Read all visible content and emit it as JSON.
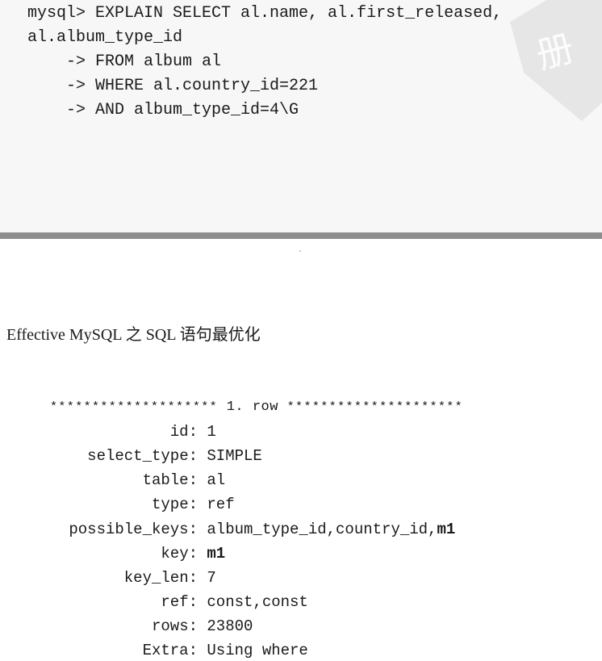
{
  "query_lines": [
    "mysql> EXPLAIN SELECT al.name, al.first_released,",
    "al.album_type_id",
    "    -> FROM album al",
    "    -> WHERE al.country_id=221",
    "    -> AND album_type_id=4\\G"
  ],
  "watermark_glyph": "册",
  "header": "Effective MySQL 之 SQL 语句最优化",
  "row_separator": {
    "stars_left": "********************",
    "label": " 1. row ",
    "stars_right": "*********************"
  },
  "fields": {
    "id": {
      "label": "id:",
      "value": "1"
    },
    "select_type": {
      "label": "select_type:",
      "value": "SIMPLE"
    },
    "table": {
      "label": "table:",
      "value": "al"
    },
    "type": {
      "label": "type:",
      "value": "ref"
    },
    "possible_keys": {
      "label": "possible_keys:",
      "value_prefix": "album_type_id,country_id,",
      "value_bold": "m1"
    },
    "key": {
      "label": "key:",
      "value_bold": "m1"
    },
    "key_len": {
      "label": "key_len:",
      "value": "7"
    },
    "ref": {
      "label": "ref:",
      "value": "const,const"
    },
    "rows": {
      "label": "rows:",
      "value": "23800"
    },
    "extra": {
      "label": "Extra:",
      "value": "Using where"
    }
  }
}
